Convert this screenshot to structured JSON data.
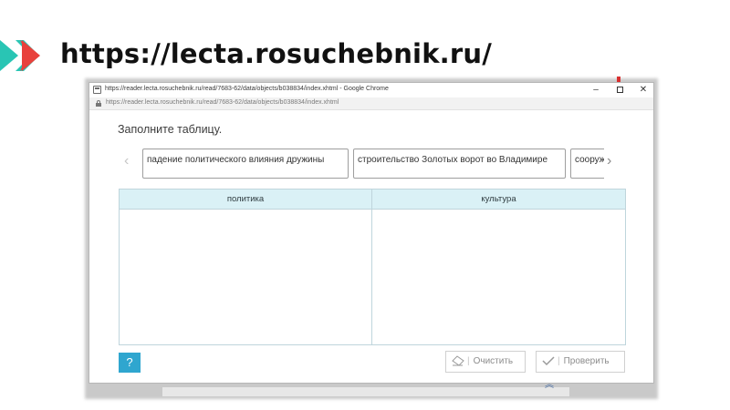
{
  "slide": {
    "title": "https://lecta.rosuchebnik.ru/",
    "logo_colors": [
      "#29c5b4",
      "#e8413c"
    ]
  },
  "window": {
    "title": "https://reader.lecta.rosuchebnik.ru/read/7683-62/data/objects/b038834/index.xhtml - Google Chrome",
    "address": "https://reader.lecta.rosuchebnik.ru/read/7683-62/data/objects/b038834/index.xhtml",
    "controls": {
      "minimize": "–",
      "close": "✕"
    }
  },
  "task": {
    "title": "Заполните таблицу.",
    "chips": [
      "падение политического влияния дружины",
      "строительство Золотых ворот во Владимире",
      "сооружение"
    ],
    "arrows": {
      "prev": "‹",
      "next": "›"
    },
    "table": {
      "columns": [
        "политика",
        "культура"
      ]
    },
    "help_label": "?",
    "buttons": {
      "clear": "Очистить",
      "check": "Проверить"
    }
  },
  "colors": {
    "table_header": "#daf1f6",
    "help_button": "#2fa6cf",
    "border": "#bfd5dc"
  }
}
